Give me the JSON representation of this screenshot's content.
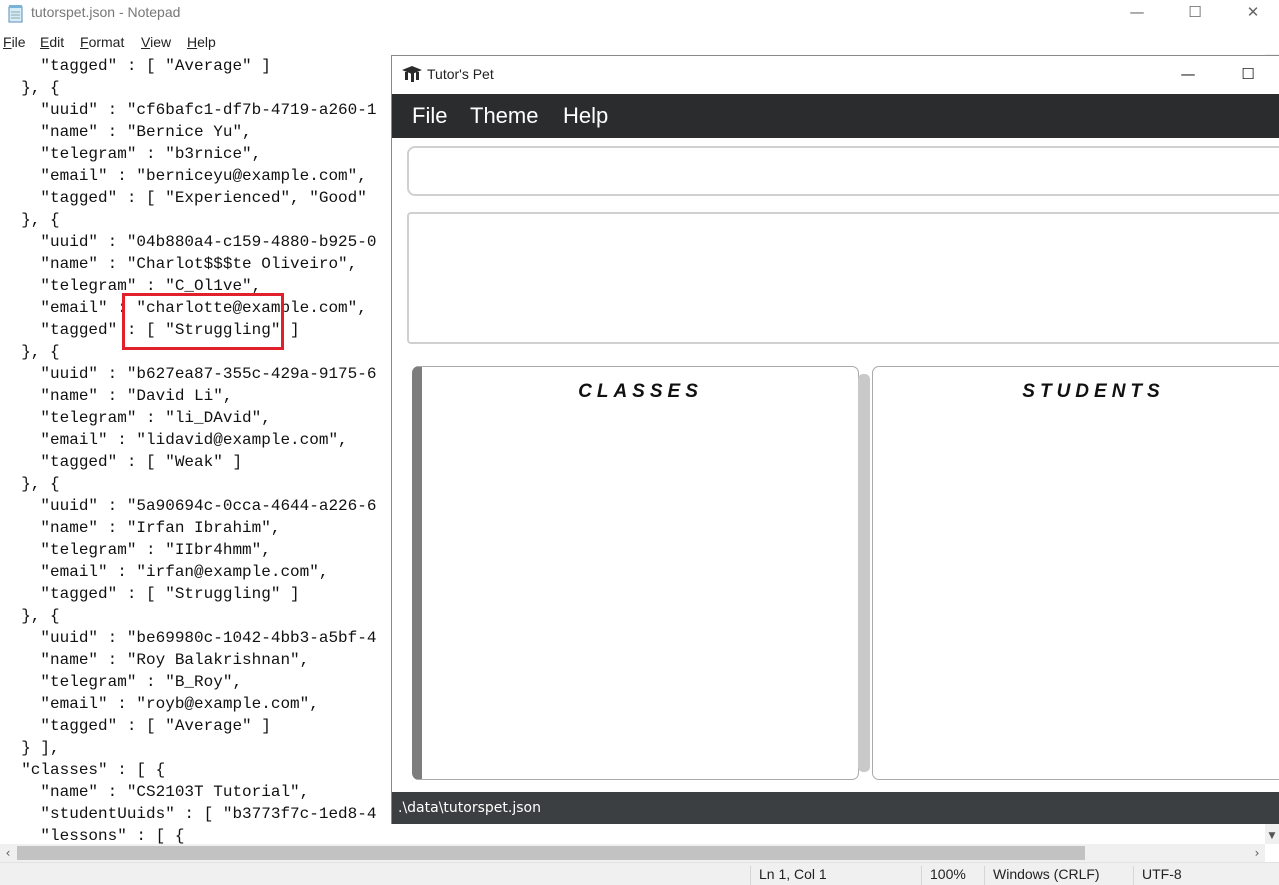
{
  "notepad": {
    "title": "tutorspet.json - Notepad",
    "controls": {
      "minimize": "—",
      "maximize": "☐",
      "close": "✕"
    },
    "menu": [
      {
        "key": "F",
        "rest": "ile"
      },
      {
        "key": "E",
        "rest": "dit"
      },
      {
        "key": "F",
        "rest": "ormat"
      },
      {
        "key": "V",
        "rest": "iew"
      },
      {
        "key": "H",
        "rest": "elp"
      }
    ],
    "lines": [
      "    \"tagged\" : [ \"Average\" ]",
      "  }, {",
      "    \"uuid\" : \"cf6bafc1-df7b-4719-a260-1",
      "    \"name\" : \"Bernice Yu\",",
      "    \"telegram\" : \"b3rnice\",",
      "    \"email\" : \"berniceyu@example.com\",",
      "    \"tagged\" : [ \"Experienced\", \"Good\"",
      "  }, {",
      "    \"uuid\" : \"04b880a4-c159-4880-b925-0",
      "    \"name\" : \"Charlot$$$te Oliveiro\",",
      "    \"telegram\" : \"C_Ol1ve\",",
      "    \"email\" : \"charlotte@example.com\",",
      "    \"tagged\" : [ \"Struggling\" ]",
      "  }, {",
      "    \"uuid\" : \"b627ea87-355c-429a-9175-6",
      "    \"name\" : \"David Li\",",
      "    \"telegram\" : \"li_DAvid\",",
      "    \"email\" : \"lidavid@example.com\",",
      "    \"tagged\" : [ \"Weak\" ]",
      "  }, {",
      "    \"uuid\" : \"5a90694c-0cca-4644-a226-6",
      "    \"name\" : \"Irfan Ibrahim\",",
      "    \"telegram\" : \"IIbr4hmm\",",
      "    \"email\" : \"irfan@example.com\",",
      "    \"tagged\" : [ \"Struggling\" ]",
      "  }, {",
      "    \"uuid\" : \"be69980c-1042-4bb3-a5bf-4",
      "    \"name\" : \"Roy Balakrishnan\",",
      "    \"telegram\" : \"B_Roy\",",
      "    \"email\" : \"royb@example.com\",",
      "    \"tagged\" : [ \"Average\" ]",
      "  } ],",
      "  \"classes\" : [ {",
      "    \"name\" : \"CS2103T Tutorial\",",
      "    \"studentUuids\" : [ \"b3773f7c-1ed8-4",
      "    \"lessons\" : [ {"
    ],
    "status": {
      "position": "Ln 1, Col 1",
      "zoom": "100%",
      "line_ending": "Windows (CRLF)",
      "encoding": "UTF-8"
    },
    "annotation_color": "#e0202a"
  },
  "tutorspet": {
    "title": "Tutor's Pet",
    "controls": {
      "minimize": "—",
      "maximize": "☐"
    },
    "menu": [
      "File",
      "Theme",
      "Help"
    ],
    "classes_title": "CLASSES",
    "students_title": "STUDENTS",
    "status_path": ".\\data\\tutorspet.json",
    "colors": {
      "menubar": "#2a2c2e",
      "statusbar": "#3c3f41"
    }
  }
}
